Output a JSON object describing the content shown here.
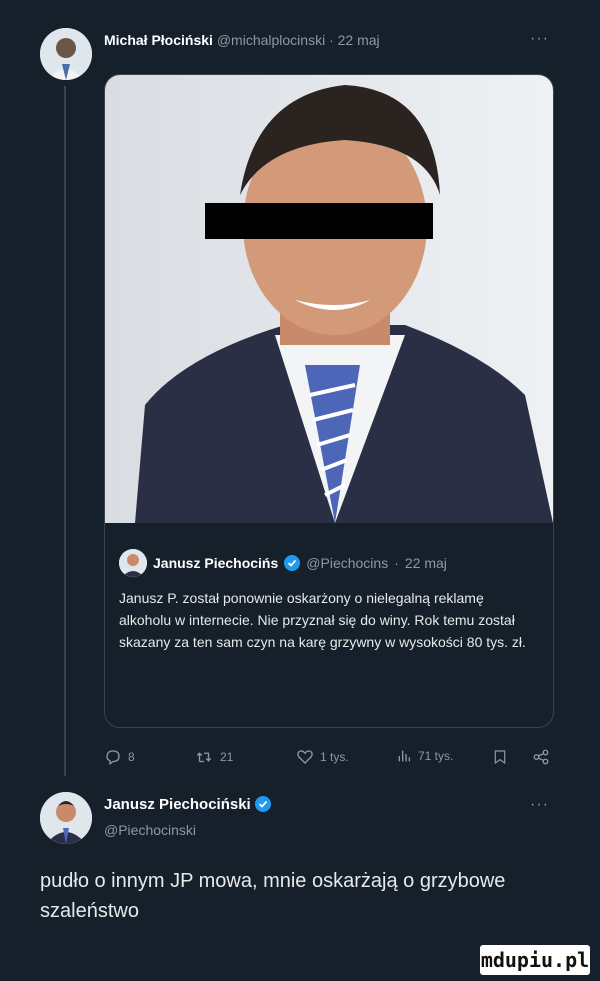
{
  "tweet1": {
    "author_name": "Michał Płociński",
    "author_handle": "@michalplocinski",
    "date": "22 maj",
    "more": "···"
  },
  "quoted": {
    "author_name": "Janusz Piechocińs",
    "author_handle": "@Piechocins",
    "date": "22 maj",
    "text": "Janusz P. został ponownie oskarżony o nielegalną reklamę alkoholu w internecie. Nie przyznał się do winy. Rok temu został skazany za ten sam czyn na karę grzywny w wysokości 80 tys. zł."
  },
  "actions": {
    "replies": "8",
    "retweets": "21",
    "likes": "1 tys.",
    "views": "71 tys."
  },
  "tweet2": {
    "author_name": "Janusz Piechociński",
    "author_handle": "@Piechocinski",
    "more": "···",
    "text": "pudło o innym JP mowa, mnie oskarżają o grzybowe szaleństwo"
  },
  "watermark": "mdupiu.pl",
  "colors": {
    "background": "#15202b",
    "border": "#38444d",
    "muted": "#8b98a5",
    "verified": "#1d9bf0"
  }
}
